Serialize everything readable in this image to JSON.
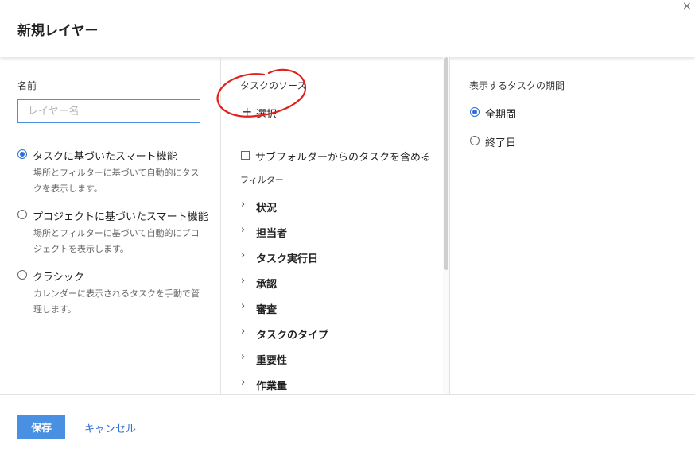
{
  "dialog": {
    "title": "新規レイヤー",
    "close_glyph": "×",
    "close_icon": "close-icon"
  },
  "left": {
    "name_label": "名前",
    "name_placeholder": "レイヤー名",
    "name_value": "",
    "options": [
      {
        "label": "タスクに基づいたスマート機能",
        "desc": "場所とフィルターに基づいて自動的にタスクを表示します。",
        "selected": true
      },
      {
        "label": "プロジェクトに基づいたスマート機能",
        "desc": "場所とフィルターに基づいて自動的にプロジェクトを表示します。",
        "selected": false
      },
      {
        "label": "クラシック",
        "desc": "カレンダーに表示されるタスクを手動で管理します。",
        "selected": false
      }
    ]
  },
  "middle": {
    "source_label": "タスクのソース",
    "select_icon": "plus-icon",
    "select_label": "選択",
    "annotation_color": "#e0201b",
    "subfolder_label": "サブフォルダーからのタスクを含める",
    "subfolder_checked": false,
    "filter_label": "フィルター",
    "filters": [
      "状況",
      "担当者",
      "タスク実行日",
      "承認",
      "審査",
      "タスクのタイプ",
      "重要性",
      "作業量"
    ]
  },
  "right": {
    "period_label": "表示するタスクの期間",
    "options": [
      {
        "label": "全期間",
        "selected": true
      },
      {
        "label": "終了日",
        "selected": false
      }
    ]
  },
  "footer": {
    "save_label": "保存",
    "cancel_label": "キャンセル"
  },
  "colors": {
    "accent": "#4a90e2",
    "link": "#2f6fd6",
    "annotation": "#e0201b"
  }
}
